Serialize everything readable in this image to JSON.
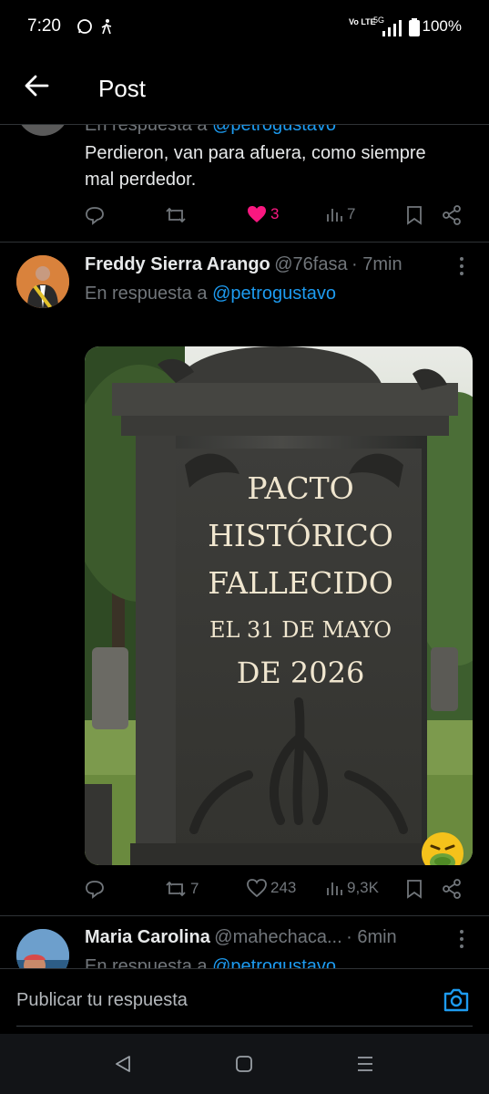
{
  "status": {
    "time": "7:20",
    "network": "Vo LTE",
    "signal": "5G",
    "battery": "100%"
  },
  "header": {
    "title": "Post"
  },
  "tweet1": {
    "reply_prefix": "En respuesta a",
    "reply_handle": "@petrogustavo",
    "text": "Perdieron, van para afuera, como siempre mal perdedor.",
    "likes": "3",
    "views": "7"
  },
  "tweet2": {
    "name": "Freddy Sierra Arango",
    "handle": "@76fasa",
    "time": "· 7min",
    "reply_prefix": "En respuesta a",
    "reply_handle": "@petrogustavo",
    "image_lines": [
      "PACTO",
      "HISTÓRICO",
      "FALLECIDO",
      "EL 31 DE MAYO",
      "DE 2026"
    ],
    "retweets": "7",
    "likes": "243",
    "views": "9,3K"
  },
  "tweet3": {
    "name": "Maria Carolina",
    "handle": "@mahechaca...",
    "time": "· 6min",
    "reply_prefix": "En respuesta a",
    "reply_handle": "@petrogustavo"
  },
  "composer": {
    "placeholder": "Publicar tu respuesta"
  }
}
